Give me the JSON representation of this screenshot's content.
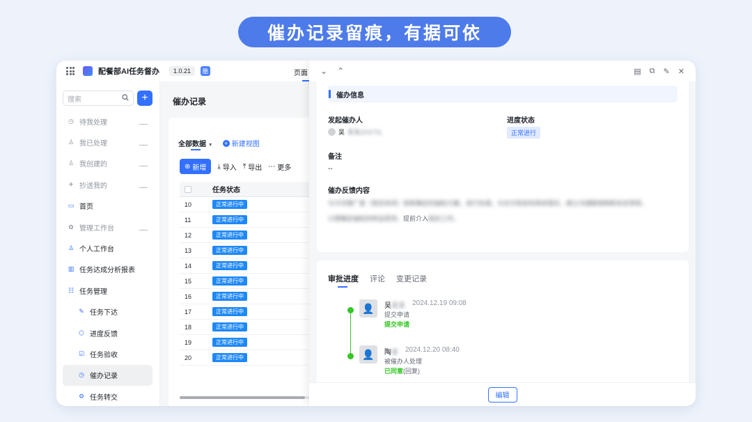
{
  "banner": "催办记录留痕，有据可依",
  "app": {
    "title": "配餐部AI任务督办",
    "version": "1.0.21",
    "avatar_char": "酷",
    "page_tab": "页面"
  },
  "sidebar": {
    "search_placeholder": "搜索",
    "add_label": "+",
    "items": [
      {
        "label": "待我处理",
        "icon": "◷",
        "muted": true
      },
      {
        "label": "我已处理",
        "icon": "♙",
        "muted": true
      },
      {
        "label": "我创建的",
        "icon": "♙",
        "muted": true
      },
      {
        "label": "抄送我的",
        "icon": "✈",
        "muted": true
      },
      {
        "label": "首页",
        "icon": "▭"
      },
      {
        "label": "管理工作台",
        "icon": "✿",
        "muted": true
      },
      {
        "label": "个人工作台",
        "icon": "♙"
      },
      {
        "label": "任务达成分析报表",
        "icon": "▥"
      },
      {
        "label": "任务管理",
        "icon": "☷"
      },
      {
        "label": "任务下达",
        "icon": "✎",
        "sub": true
      },
      {
        "label": "进度反馈",
        "icon": "⬡",
        "sub": true
      },
      {
        "label": "任务验收",
        "icon": "☑",
        "sub": true
      },
      {
        "label": "催办记录",
        "icon": "◷",
        "sub": true,
        "active": true
      },
      {
        "label": "任务转交",
        "icon": "⚙",
        "sub": true
      }
    ]
  },
  "list": {
    "title": "催办记录",
    "view_all": "全部数据",
    "new_view": "新建视图",
    "toolbar": {
      "new": "新增",
      "import": "导入",
      "export": "导出",
      "more": "更多"
    },
    "column_header": "任务状态",
    "rows": [
      {
        "num": "10",
        "status": "正常进行中"
      },
      {
        "num": "11",
        "status": "正常进行中"
      },
      {
        "num": "12",
        "status": "正常进行中"
      },
      {
        "num": "13",
        "status": "正常进行中"
      },
      {
        "num": "14",
        "status": "正常进行中"
      },
      {
        "num": "15",
        "status": "正常进行中"
      },
      {
        "num": "16",
        "status": "正常进行中"
      },
      {
        "num": "17",
        "status": "正常进行中"
      },
      {
        "num": "18",
        "status": "正常进行中"
      },
      {
        "num": "19",
        "status": "正常进行中"
      },
      {
        "num": "20",
        "status": "正常进行中"
      }
    ]
  },
  "detail": {
    "section_title": "催办信息",
    "initiator_label": "发起催办人",
    "initiator_name": "吴",
    "initiator_blurred": "某某(00275)",
    "status_label": "进度状态",
    "status_value": "正常进行",
    "remark_label": "备注",
    "remark_value": "--",
    "feedback_label": "催办反馈内容",
    "feedback_line1_blur": "与冷冻餐厂家（南京休闲）就新确定的抽检方案，进行协调。与对方就如何具体落实，建立沟通联络刷新状态常规，",
    "feedback_line2_blur": "以便确定抽检的样品现场，",
    "feedback_line2_clear": "提前介入",
    "feedback_line2_tail": "相关工作。",
    "tabs": [
      "审批进度",
      "评论",
      "变更记录"
    ],
    "timeline": [
      {
        "name": "吴",
        "name_blur": "某某",
        "time": "2024.12.19 09:08",
        "action": "提交申请",
        "result": "提交申请",
        "note": ""
      },
      {
        "name": "陶",
        "name_blur": "某",
        "time": "2024.12.20 08:40",
        "action": "被催办人处理",
        "result": "已同意",
        "note": "(回复)"
      }
    ],
    "edit_label": "编辑"
  },
  "colors": {
    "accent": "#3370ff",
    "banner": "#4e7bea",
    "success": "#34c724",
    "status_tag": "#1e88f7"
  }
}
